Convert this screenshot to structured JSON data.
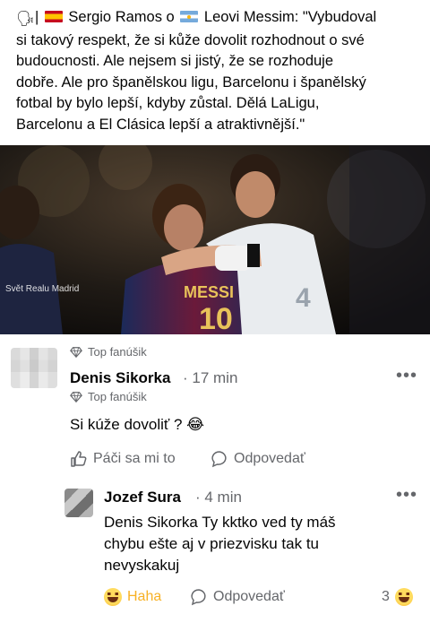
{
  "post": {
    "speech_emoji": "🗣",
    "text_lines": [
      "| Sergio Ramos o Leovi Messim: \"Vybudoval",
      "si takový respekt, že si kůže dovolit rozhodnout o své",
      "budoucnosti. Ale nejsem si jistý, že se rozhoduje",
      "dobře.  Ale pro španělskou ligu, Barcelonu i španělský",
      "fotbal by bylo lepší, kdyby zůstal. Dělá LaLigu,",
      "Barcelonu a El Clásica lepší a atraktivnější.\""
    ],
    "line1_part_a": "| ",
    "line1_part_b": " Sergio Ramos o ",
    "line1_part_c": " Leovi Messim: \"Vybudoval",
    "photo_watermark": "Svět Realu Madrid",
    "photo_jersey_text": "MESSI",
    "photo_jersey_number": "10"
  },
  "comments": [
    {
      "badge": "Top fanúšik",
      "author": "Denis Sikorka",
      "time": "· 17 min",
      "sub_badge": "Top fanúšik",
      "text": "Si kúže dovoliť ? 😂",
      "like_label": "Páči sa mi to",
      "reply_label": "Odpovedať"
    },
    {
      "author": "Jozef Sura",
      "time": "· 4 min",
      "text_lines": [
        "Denis Sikorka Ty kktko ved ty máš",
        "chybu ešte aj v priezvisku tak tu",
        "nevyskakuj"
      ],
      "reaction_label": "Haha",
      "reply_label": "Odpovedať",
      "reaction_count": "3"
    }
  ],
  "icons": {
    "more": "•••",
    "badge": "diamond-icon",
    "like": "thumbs-up-icon",
    "reply": "speech-bubble-icon",
    "haha": "haha-emoji-icon"
  },
  "colors": {
    "text": "#050505",
    "secondary": "#65676b",
    "haha": "#f7b125"
  }
}
